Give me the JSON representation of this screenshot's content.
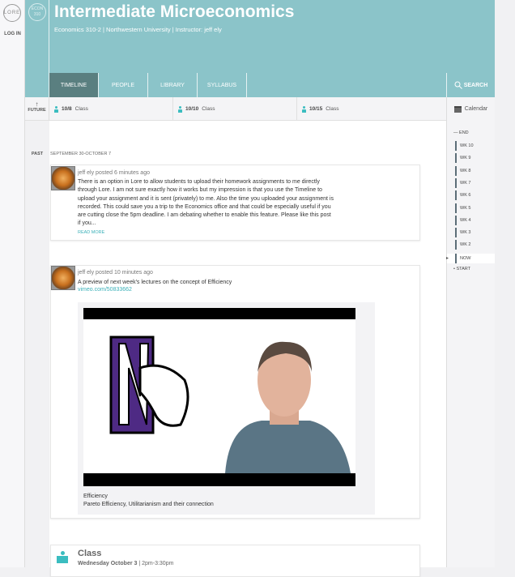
{
  "app": {
    "logo": "LORE",
    "login": "LOG IN"
  },
  "course": {
    "badge": "ECON 310",
    "title": "Intermediate Microeconomics",
    "subtitle": "Economics 310-2 | Northwestern University | Instructor: jeff ely"
  },
  "tabs": [
    {
      "label": "TIMELINE",
      "active": true
    },
    {
      "label": "PEOPLE"
    },
    {
      "label": "LIBRARY"
    },
    {
      "label": "SYLLABUS"
    }
  ],
  "search": {
    "label": "SEARCH",
    "icon": "search-icon"
  },
  "future": {
    "label": "FUTURE",
    "items": [
      {
        "date": "10/8",
        "label": "Class"
      },
      {
        "date": "10/10",
        "label": "Class"
      },
      {
        "date": "10/15",
        "label": "Class"
      }
    ]
  },
  "calendar": {
    "label": "Calendar"
  },
  "past": {
    "label": "PAST",
    "range": "SEPTEMBER 30-OCTOBER 7"
  },
  "weeks": {
    "end": "END",
    "items": [
      "WK 10",
      "WK 9",
      "WK 8",
      "WK 7",
      "WK 6",
      "WK 5",
      "WK 4",
      "WK 3",
      "WK 2"
    ],
    "now": "NOW",
    "start": "START"
  },
  "posts": [
    {
      "meta": "jeff ely posted 6 minutes ago",
      "body": "There is an option in Lore to allow students to upload their homework assignments to me directly through Lore. I am not sure exactly how it works but my impression is that you use the Timeline to upload your assignment and it is sent (privately) to me. Also the time you uploaded your assignment is recorded. This could save you a trip to the Economics office and that could be especially useful if you are cutting close the 5pm deadline. I am debating whether to enable this feature. Please like this post if you...",
      "more": "READ MORE"
    },
    {
      "meta": "jeff ely posted 10 minutes ago",
      "body": "A preview of next week's lectures on the concept of Efficiency",
      "link": "vimeo.com/50833662",
      "video_title": "Efficiency",
      "video_desc": "Pareto Efficiency, Utilitarianism and their connection"
    }
  ],
  "class_event": {
    "title": "Class",
    "date": "Wednesday October 3",
    "time": "2pm-3:30pm"
  },
  "colors": {
    "header": "#8bc4c9",
    "active_tab": "#5a7f80",
    "accent": "#3bbdc0"
  }
}
